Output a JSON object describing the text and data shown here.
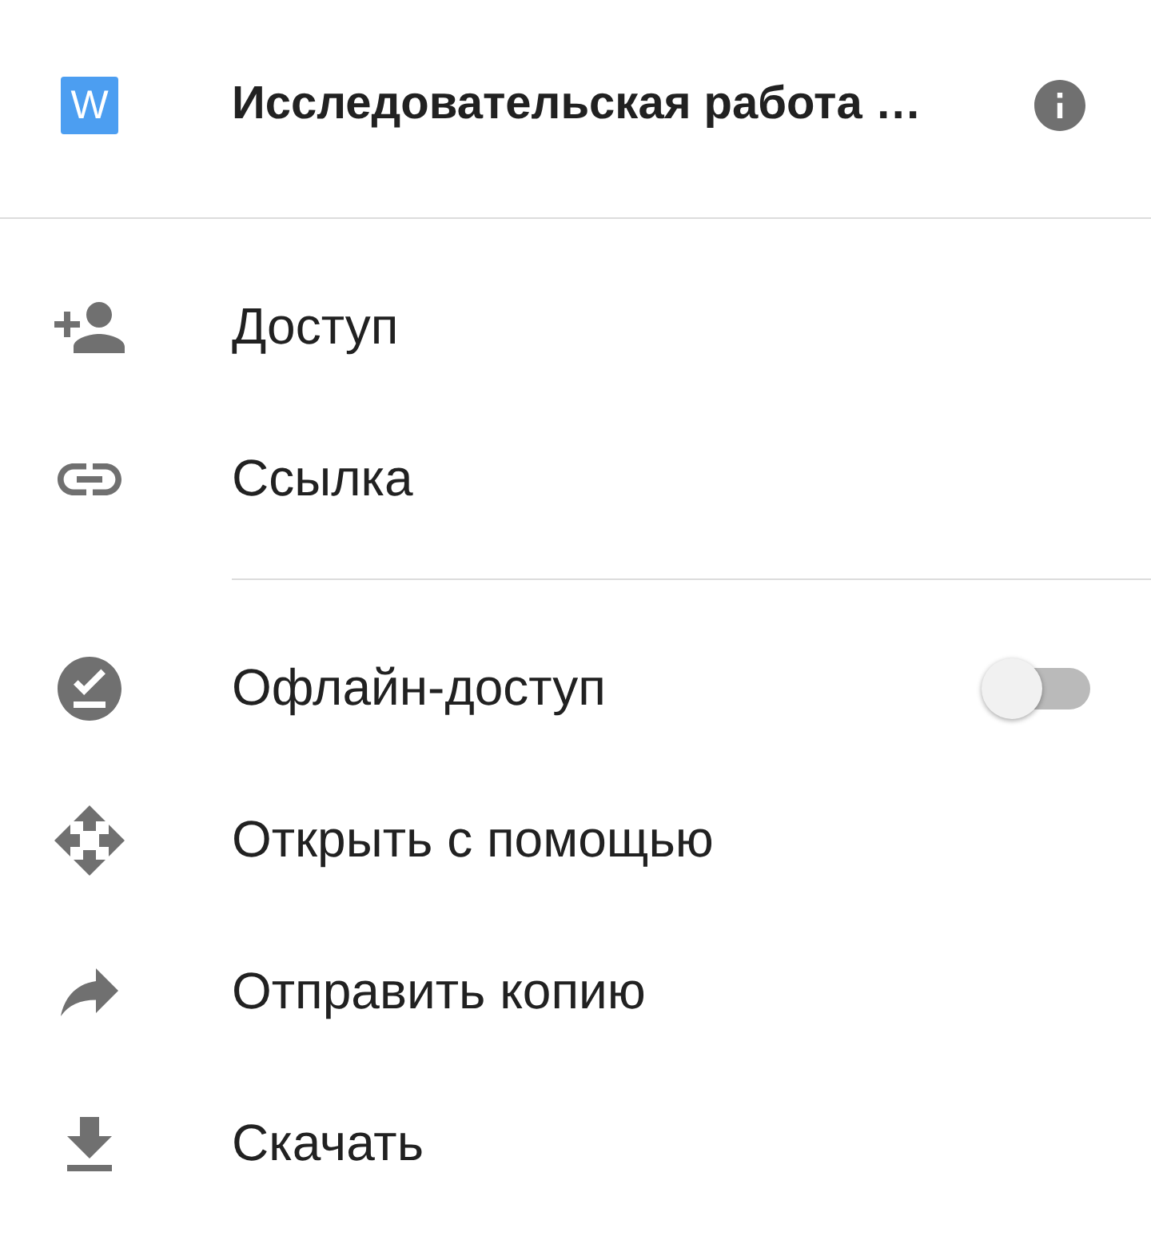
{
  "header": {
    "file_badge": "W",
    "title": "Исследовательская работа …"
  },
  "sections": [
    {
      "items": [
        {
          "kind": "action",
          "label": "Доступ"
        },
        {
          "kind": "action",
          "label": "Ссылка"
        }
      ]
    },
    {
      "items": [
        {
          "kind": "toggle",
          "label": "Офлайн-доступ",
          "on": false
        },
        {
          "kind": "action",
          "label": "Открыть с помощью"
        },
        {
          "kind": "action",
          "label": "Отправить копию"
        },
        {
          "kind": "action",
          "label": "Скачать"
        }
      ]
    }
  ]
}
